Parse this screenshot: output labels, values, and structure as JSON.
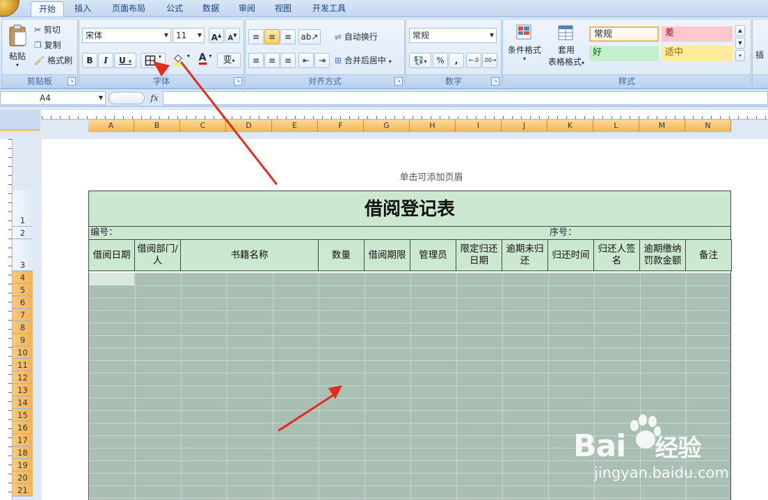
{
  "tabs": [
    "开始",
    "插入",
    "页面布局",
    "公式",
    "数据",
    "审阅",
    "视图",
    "开发工具"
  ],
  "clipboard": {
    "paste": "粘贴",
    "cut": "剪切",
    "copy": "复制",
    "format_painter": "格式刷",
    "label": "剪贴板"
  },
  "font": {
    "name": "宋体",
    "size": "11",
    "bold": "B",
    "italic": "I",
    "underline": "U",
    "label": "字体"
  },
  "alignment": {
    "wrap": "自动换行",
    "merge": "合并后居中",
    "label": "对齐方式"
  },
  "number": {
    "format": "常规",
    "percent": "%",
    "comma": ",",
    "label": "数字"
  },
  "styles": {
    "conditional": "条件格式",
    "table_line1": "套用",
    "table_line2": "表格格式",
    "normal": "常规",
    "bad": "差",
    "good": "好",
    "neutral": "适中",
    "label": "样式",
    "insert": "插"
  },
  "formula_bar": {
    "cell_ref": "A4",
    "fx": "fx"
  },
  "columns": [
    "A",
    "B",
    "C",
    "D",
    "E",
    "F",
    "G",
    "H",
    "I",
    "J",
    "K",
    "L",
    "M",
    "N"
  ],
  "rows": [
    "1",
    "2",
    "3",
    "4",
    "5",
    "6",
    "7",
    "8",
    "9",
    "10",
    "11",
    "12",
    "13",
    "14",
    "15",
    "16",
    "17",
    "18",
    "19",
    "20",
    "21"
  ],
  "header_hint": "单击可添加页眉",
  "sheet": {
    "title": "借阅登记表",
    "number_label": "编号：",
    "seq_label": "序号：",
    "headers": [
      "借阅日期",
      "借阅部门/人",
      "书籍名称",
      "数量",
      "借阅期限",
      "管理员",
      "限定归还日期",
      "逾期未归还",
      "归还时间",
      "归还人签名",
      "逾期缴纳罚款金额",
      "备注"
    ]
  },
  "watermark": {
    "brand": "Bai",
    "brand2": "经验",
    "url": "jingyan.baidu.com"
  },
  "colors": {
    "accent": "#e62b1a",
    "title_bg": "#cde8d0",
    "grid": "#a9bfb3"
  }
}
